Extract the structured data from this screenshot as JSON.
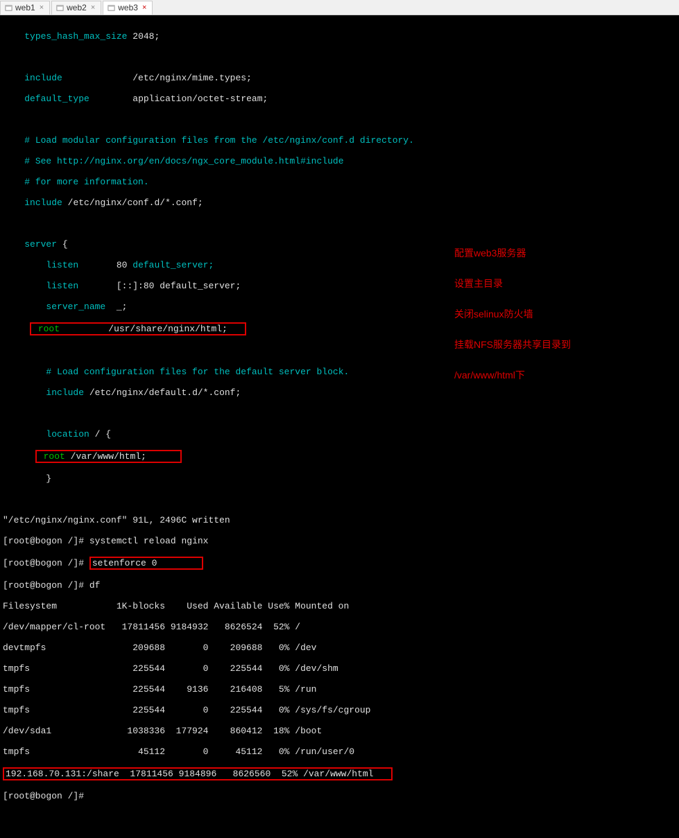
{
  "tabs": [
    {
      "label": "web1"
    },
    {
      "label": "web2"
    },
    {
      "label": "web3"
    }
  ],
  "config": {
    "types_hash": "types_hash_max_size",
    "types_hash_val": "2048;",
    "include1": "include",
    "include1_val": "/etc/nginx/mime.types;",
    "default_type": "default_type",
    "default_type_val": "application/octet-stream;",
    "comment1": "# Load modular configuration files from the /etc/nginx/conf.d directory.",
    "comment2": "# See http://nginx.org/en/docs/ngx_core_module.html#include",
    "comment3": "# for more information.",
    "include2": "include",
    "include2_val": "/etc/nginx/conf.d/*.conf;",
    "server": "server",
    "brace_open": "{",
    "listen1": "listen",
    "listen1_val": "80",
    "listen1_rest": "default_server;",
    "listen2": "listen",
    "listen2_val": "[::]:80 default_server;",
    "server_name": "server_name",
    "server_name_val": "_;",
    "root1": "root",
    "root1_val": "/usr/share/nginx/html;",
    "comment4": "# Load configuration files for the default server block.",
    "include3": "include",
    "include3_val": "/etc/nginx/default.d/*.conf;",
    "location": "location",
    "location_val": "/ {",
    "root2": "root",
    "root2_val": "/var/www/html;",
    "brace_close": "}"
  },
  "term": {
    "written": "\"/etc/nginx/nginx.conf\" 91L, 2496C written",
    "prompt1_a": "[root@bogon /]#",
    "cmd1": "systemctl reload nginx",
    "prompt2_a": "[root@bogon /]#",
    "cmd2": "setenforce 0",
    "prompt3_a": "[root@bogon /]#",
    "cmd3": "df",
    "df_header": "Filesystem           1K-blocks    Used Available Use% Mounted on",
    "df_rows": [
      "/dev/mapper/cl-root   17811456 9184932   8626524  52% /",
      "devtmpfs                209688       0    209688   0% /dev",
      "tmpfs                   225544       0    225544   0% /dev/shm",
      "tmpfs                   225544    9136    216408   5% /run",
      "tmpfs                   225544       0    225544   0% /sys/fs/cgroup",
      "/dev/sda1              1038336  177924    860412  18% /boot",
      "tmpfs                    45112       0     45112   0% /run/user/0"
    ],
    "df_nfs": "192.168.70.131:/share  17811456 9184896   8626560  52% /var/www/html",
    "prompt4_a": "[root@bogon /]#"
  },
  "annotation": {
    "l1": "配置web3服务器",
    "l2": "设置主目录",
    "l3": "关闭selinux防火墙",
    "l4": "挂载NFS服务器共享目录到",
    "l5": "/var/www/html下"
  }
}
